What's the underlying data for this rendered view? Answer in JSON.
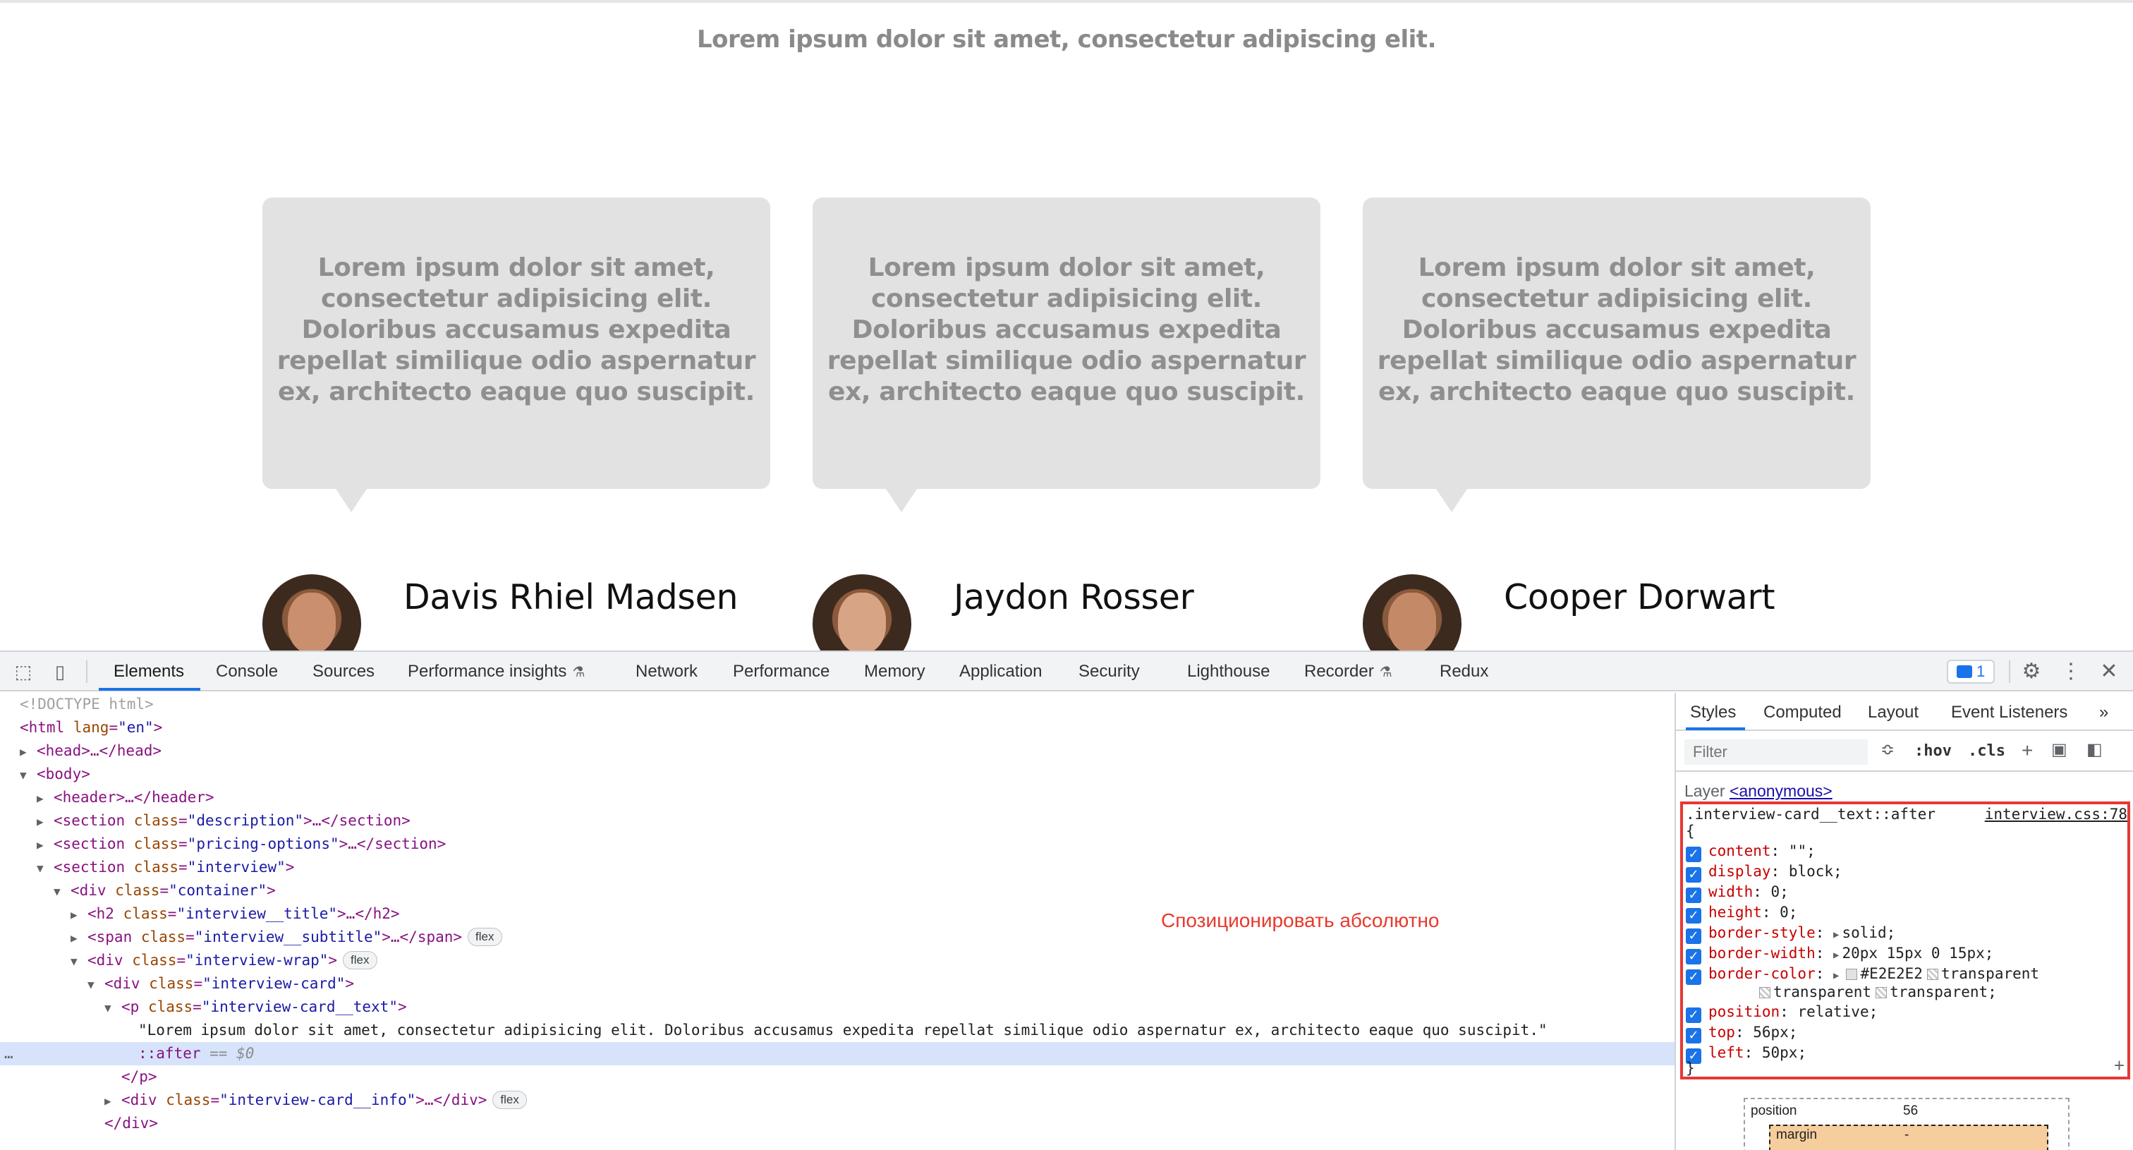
{
  "page": {
    "subtitle": "Lorem ipsum dolor sit amet, consectetur adipiscing elit.",
    "card_text": "Lorem ipsum dolor sit amet, consectetur adipisicing elit. Doloribus accusamus expedita repellat similique odio aspernatur ex, architecto eaque quo suscipit.",
    "people": [
      {
        "name": "Davis Rhiel Madsen"
      },
      {
        "name": "Jaydon Rosser"
      },
      {
        "name": "Cooper Dorwart"
      }
    ]
  },
  "devtools": {
    "tabs": [
      "Elements",
      "Console",
      "Sources",
      "Performance insights",
      "Network",
      "Performance",
      "Memory",
      "Application",
      "Security",
      "Lighthouse",
      "Recorder",
      "Redux"
    ],
    "issues_count": "1",
    "dom": {
      "doctype": "<!DOCTYPE html>",
      "html_open": "<html ",
      "html_attr": "lang",
      "html_val": "\"en\"",
      "head": "<head>…</head>",
      "body": "<body>",
      "header": "<header>…</header>",
      "section_desc_val": "\"description\"",
      "section_pricing_val": "\"pricing-options\"",
      "section_interview_val": "\"interview\"",
      "container_val": "\"container\"",
      "h2_val": "\"interview__title\"",
      "span_val": "\"interview__subtitle\"",
      "wrap_val": "\"interview-wrap\"",
      "card_val": "\"interview-card\"",
      "p_val": "\"interview-card__text\"",
      "p_text": "\"Lorem ipsum dolor sit amet, consectetur adipisicing elit. Doloribus accusamus expedita repellat similique odio aspernatur ex, architecto eaque quo suscipit.\"",
      "after": "::after",
      "after_eq": " == $0",
      "p_close": "</p>",
      "info_val": "\"interview-card__info\"",
      "div_close": "</div>",
      "flex_chip": "flex",
      "ellipsis": "…"
    },
    "annotation": "Спозиционировать абсолютно",
    "styles": {
      "tabs": [
        "Styles",
        "Computed",
        "Layout",
        "Event Listeners"
      ],
      "filter_placeholder": "Filter",
      "hov": ":hov",
      "cls": ".cls",
      "layer_label": "Layer",
      "layer_link": "<anonymous>",
      "selector": ".interview-card__text::after",
      "source": "interview.css:78",
      "open_brace": "{",
      "close_brace": "}",
      "declarations": [
        {
          "prop": "content",
          "value": "\"\";"
        },
        {
          "prop": "display",
          "value": "block;"
        },
        {
          "prop": "width",
          "value": "0;"
        },
        {
          "prop": "height",
          "value": "0;"
        },
        {
          "prop": "border-style",
          "value": "solid;"
        },
        {
          "prop": "border-width",
          "value": "20px 15px 0 15px;"
        },
        {
          "prop": "border-color",
          "value": "#E2E2E2"
        },
        {
          "prop": "position",
          "value": "relative;"
        },
        {
          "prop": "top",
          "value": "56px;"
        },
        {
          "prop": "left",
          "value": "50px;"
        }
      ],
      "border_color_parts": [
        "transparent",
        "transparent",
        "transparent;"
      ],
      "box_position_label": "position",
      "box_position_value": "56",
      "box_margin_label": "margin",
      "box_margin_value": "-"
    },
    "colors": {
      "accent": "#1a73e8",
      "highlight": "#e53935",
      "card_bg": "#E2E2E2"
    }
  }
}
